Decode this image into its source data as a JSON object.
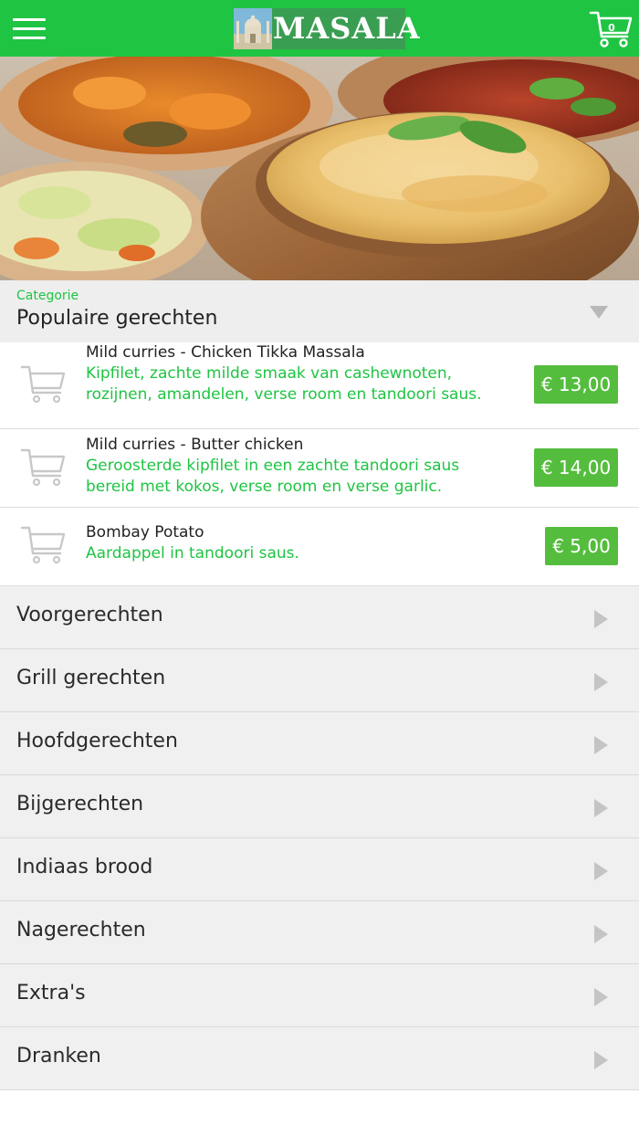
{
  "header": {
    "logo_text": "MASALA",
    "cart_count": "0",
    "brand_color": "#1fc443",
    "icons": [
      "hamburger-menu-icon",
      "cart-icon"
    ]
  },
  "category": {
    "label": "Categorie",
    "selected": "Populaire gerechten"
  },
  "dishes": [
    {
      "name": "Mild curries - Chicken Tikka Massala",
      "description": "Kipfilet, zachte milde smaak van cashewnoten, rozijnen, amandelen, verse room en tandoori saus.",
      "price": "€ 13,00"
    },
    {
      "name": "Mild curries - Butter chicken",
      "description": "Geroosterde kipfilet in een zachte tandoori saus bereid met kokos, verse room en verse garlic.",
      "price": "€ 14,00"
    },
    {
      "name": "Bombay Potato",
      "description": "Aardappel in tandoori saus.",
      "price": "€ 5,00"
    }
  ],
  "menu_categories": [
    "Voorgerechten",
    "Grill gerechten",
    "Hoofdgerechten",
    "Bijgerechten",
    "Indiaas brood",
    "Nagerechten",
    "Extra's",
    "Dranken"
  ],
  "colors": {
    "accent": "#1fc443",
    "price_button": "#55bd3e",
    "row_background": "#f0f0f0"
  }
}
